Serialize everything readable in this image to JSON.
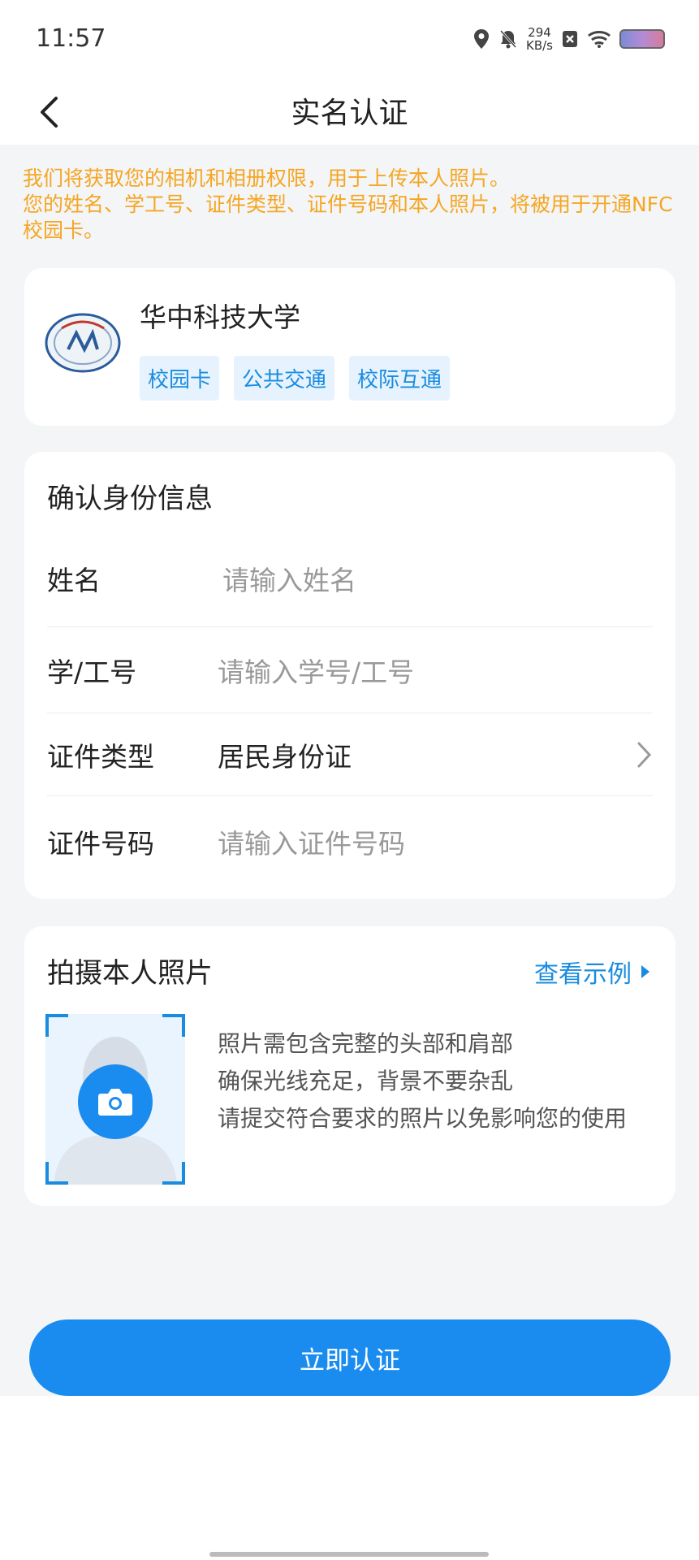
{
  "status_bar": {
    "time": "11:57",
    "speed_value": "294",
    "speed_unit": "KB/s",
    "icons": [
      "location-icon",
      "mute-bell-icon",
      "sim-x-icon",
      "wifi-icon",
      "battery-icon"
    ]
  },
  "nav": {
    "title": "实名认证",
    "back_icon": "chevron-left-icon"
  },
  "notice": {
    "line1": "我们将获取您的相机和相册权限，用于上传本人照片。",
    "line2": "您的姓名、学工号、证件类型、证件号码和本人照片，将被用于开通NFC校园卡。"
  },
  "school": {
    "name": "华中科技大学",
    "tags": [
      "校园卡",
      "公共交通",
      "校际互通"
    ]
  },
  "identity": {
    "title": "确认身份信息",
    "fields": [
      {
        "label": "姓名",
        "placeholder": "请输入姓名"
      },
      {
        "label": "学/工号",
        "placeholder": "请输入学号/工号"
      },
      {
        "label": "证件类型",
        "value": "居民身份证"
      },
      {
        "label": "证件号码",
        "placeholder": "请输入证件号码"
      }
    ]
  },
  "photo": {
    "title": "拍摄本人照片",
    "example_link": "查看示例",
    "tips": [
      "照片需包含完整的头部和肩部",
      "确保光线充足，背景不要杂乱",
      "请提交符合要求的照片以免影响您的使用"
    ]
  },
  "submit": {
    "label": "立即认证"
  },
  "colors": {
    "accent": "#1a8cf0",
    "link": "#1a8cdf",
    "notice": "#f5a623",
    "background": "#f4f5f7"
  }
}
